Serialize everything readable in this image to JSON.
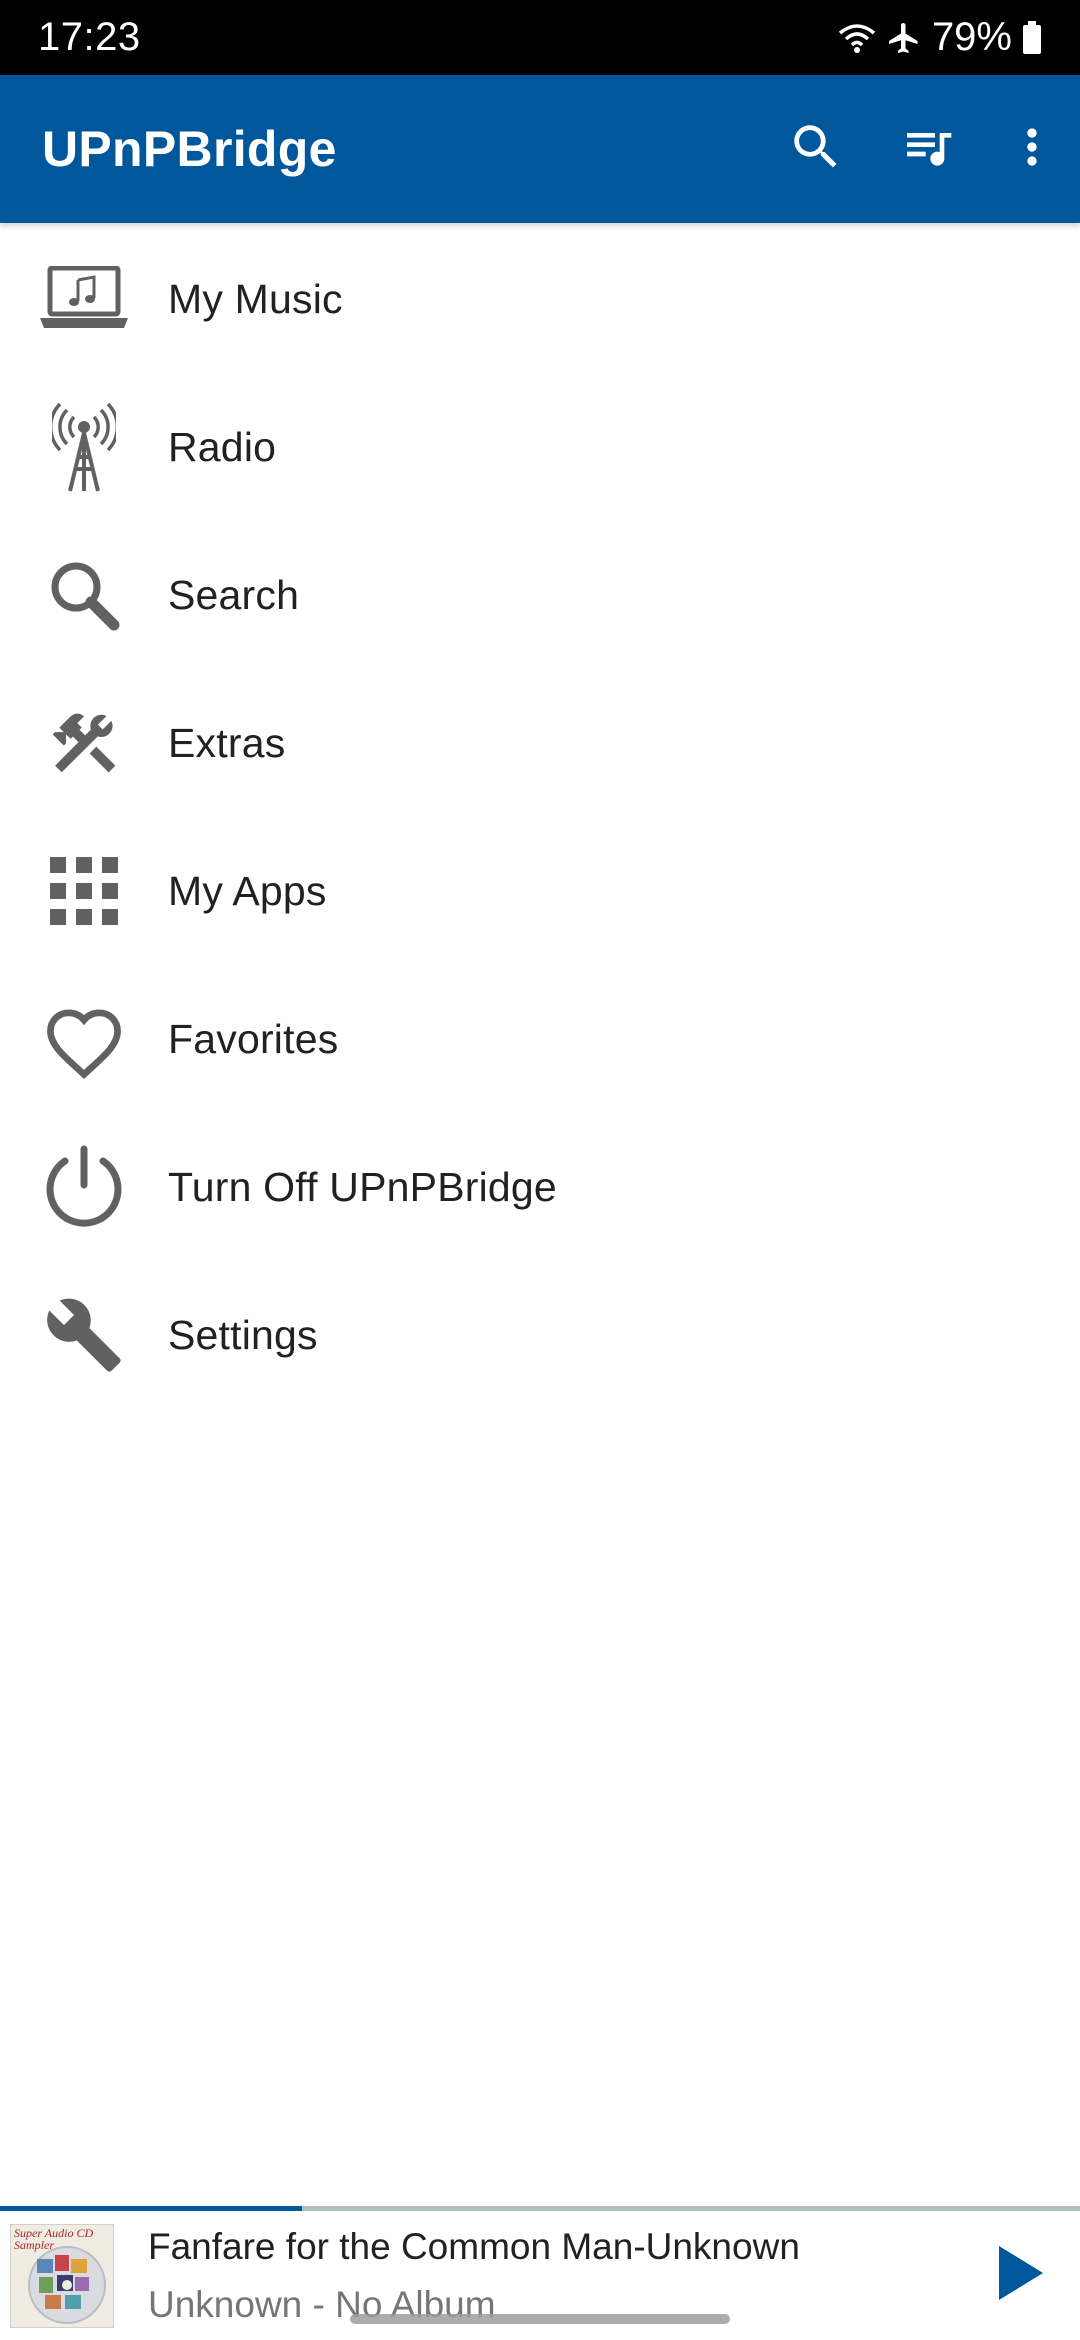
{
  "status_bar": {
    "time": "17:23",
    "battery": "79%",
    "icons": [
      "wifi-icon",
      "airplane-mode-icon",
      "battery-icon"
    ]
  },
  "app_bar": {
    "title": "UPnPBridge",
    "actions": [
      "search-icon",
      "queue-music-icon",
      "more-vert-icon"
    ],
    "color": "#01579b"
  },
  "menu": {
    "items": [
      {
        "label": "My Music",
        "icon": "laptop-music-icon"
      },
      {
        "label": "Radio",
        "icon": "radio-tower-icon"
      },
      {
        "label": "Search",
        "icon": "search-icon"
      },
      {
        "label": "Extras",
        "icon": "tools-icon"
      },
      {
        "label": "My Apps",
        "icon": "apps-grid-icon"
      },
      {
        "label": "Favorites",
        "icon": "heart-icon"
      },
      {
        "label": "Turn Off UPnPBridge",
        "icon": "power-icon"
      },
      {
        "label": "Settings",
        "icon": "wrench-icon"
      }
    ],
    "icon_color": "#616161"
  },
  "player": {
    "progress_fraction": 0.28,
    "album_art_text": "Super Audio CD Sampler",
    "title": "Fanfare for the Common Man-Unknown",
    "subtitle": "Unknown - No Album",
    "play_icon": "play-icon"
  }
}
